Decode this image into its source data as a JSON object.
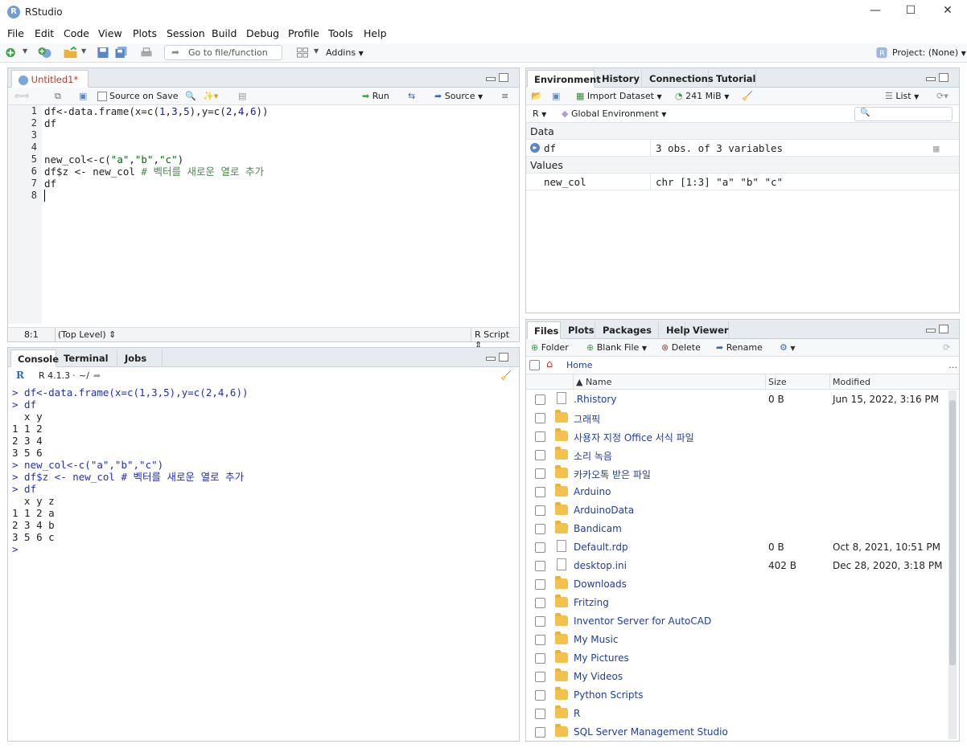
{
  "window": {
    "title": "RStudio",
    "logo_letter": "R",
    "minimize": "—",
    "maximize": "☐",
    "close": "✕"
  },
  "menu": [
    "File",
    "Edit",
    "Code",
    "View",
    "Plots",
    "Session",
    "Build",
    "Debug",
    "Profile",
    "Tools",
    "Help"
  ],
  "toolbar": {
    "goto_placeholder": "Go to file/function",
    "addins_label": "Addins",
    "project_label": "Project: (None)"
  },
  "editor": {
    "tab_label": "Untitled1*",
    "source_on_save": "Source on Save",
    "run_label": "Run",
    "source_label": "Source",
    "line_numbers": [
      "1",
      "2",
      "3",
      "4",
      "5",
      "6",
      "7",
      "8"
    ],
    "lines": [
      "df<-data.frame(x=c(1,3,5),y=c(2,4,6))",
      "df",
      "",
      "",
      "new_col<-c(\"a\",\"b\",\"c\")",
      "df$z <- new_col # 벡터를 새로운 열로 추가",
      "df",
      ""
    ],
    "status_position": "8:1",
    "status_scope": "(Top Level)",
    "status_type": "R Script"
  },
  "console": {
    "tabs": [
      "Console",
      "Terminal",
      "Jobs"
    ],
    "r_version": "R 4.1.3",
    "wd": "~/",
    "lines": [
      {
        "t": "in",
        "s": "> df<-data.frame(x=c(1,3,5),y=c(2,4,6))"
      },
      {
        "t": "in",
        "s": "> df"
      },
      {
        "t": "out",
        "s": "  x y"
      },
      {
        "t": "out",
        "s": "1 1 2"
      },
      {
        "t": "out",
        "s": "2 3 4"
      },
      {
        "t": "out",
        "s": "3 5 6"
      },
      {
        "t": "in",
        "s": "> new_col<-c(\"a\",\"b\",\"c\")"
      },
      {
        "t": "in",
        "s": "> df$z <- new_col # 벡터를 새로운 열로 추가"
      },
      {
        "t": "in",
        "s": "> df"
      },
      {
        "t": "out",
        "s": "  x y z"
      },
      {
        "t": "out",
        "s": "1 1 2 a"
      },
      {
        "t": "out",
        "s": "2 3 4 b"
      },
      {
        "t": "out",
        "s": "3 5 6 c"
      },
      {
        "t": "in",
        "s": "> "
      }
    ]
  },
  "environment": {
    "tabs": [
      "Environment",
      "History",
      "Connections",
      "Tutorial"
    ],
    "import_label": "Import Dataset",
    "memory_label": "241 MiB",
    "list_label": "List",
    "lang_label": "R",
    "scope_label": "Global Environment",
    "data_header": "Data",
    "data_rows": [
      {
        "name": "df",
        "value": "3 obs. of 3 variables"
      }
    ],
    "values_header": "Values",
    "values_rows": [
      {
        "name": "new_col",
        "value": "chr [1:3] \"a\" \"b\" \"c\""
      }
    ]
  },
  "files": {
    "tabs": [
      "Files",
      "Plots",
      "Packages",
      "Help",
      "Viewer"
    ],
    "folder_label": "Folder",
    "blank_file_label": "Blank File",
    "delete_label": "Delete",
    "rename_label": "Rename",
    "home_label": "Home",
    "col_name": "▲ Name",
    "col_size": "Size",
    "col_modified": "Modified",
    "rows": [
      {
        "name": ".Rhistory",
        "type": "history",
        "size": "0 B",
        "modified": "Jun 15, 2022, 3:16 PM"
      },
      {
        "name": "그래픽",
        "type": "folder",
        "size": "",
        "modified": ""
      },
      {
        "name": "사용자 지정 Office 서식 파일",
        "type": "folder",
        "size": "",
        "modified": ""
      },
      {
        "name": "소리 녹음",
        "type": "folder",
        "size": "",
        "modified": ""
      },
      {
        "name": "카카오톡 받은 파일",
        "type": "folder",
        "size": "",
        "modified": ""
      },
      {
        "name": "Arduino",
        "type": "folder",
        "size": "",
        "modified": ""
      },
      {
        "name": "ArduinoData",
        "type": "folder",
        "size": "",
        "modified": ""
      },
      {
        "name": "Bandicam",
        "type": "folder",
        "size": "",
        "modified": ""
      },
      {
        "name": "Default.rdp",
        "type": "file",
        "size": "0 B",
        "modified": "Oct 8, 2021, 10:51 PM"
      },
      {
        "name": "desktop.ini",
        "type": "settings",
        "size": "402 B",
        "modified": "Dec 28, 2020, 3:18 PM"
      },
      {
        "name": "Downloads",
        "type": "folder",
        "size": "",
        "modified": ""
      },
      {
        "name": "Fritzing",
        "type": "folder",
        "size": "",
        "modified": ""
      },
      {
        "name": "Inventor Server for AutoCAD",
        "type": "folder",
        "size": "",
        "modified": ""
      },
      {
        "name": "My Music",
        "type": "folder",
        "size": "",
        "modified": ""
      },
      {
        "name": "My Pictures",
        "type": "folder",
        "size": "",
        "modified": ""
      },
      {
        "name": "My Videos",
        "type": "folder",
        "size": "",
        "modified": ""
      },
      {
        "name": "Python Scripts",
        "type": "folder",
        "size": "",
        "modified": ""
      },
      {
        "name": "R",
        "type": "folder",
        "size": "",
        "modified": ""
      },
      {
        "name": "SQL Server Management Studio",
        "type": "folder",
        "size": "",
        "modified": ""
      }
    ]
  }
}
